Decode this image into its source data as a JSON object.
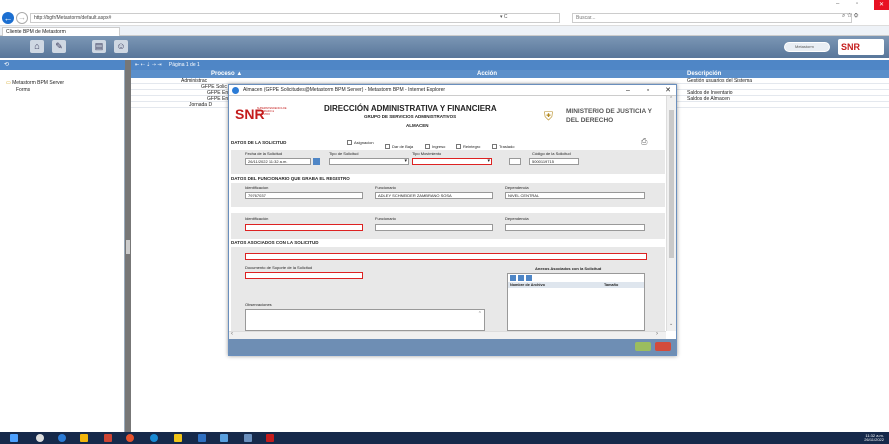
{
  "browser": {
    "url": "http://bgfr/Metastorm/default.aspx#",
    "url_controls": "▾ C",
    "search_placeholder": "Buscar...",
    "tab_title": "Cliente BPM de Metastorm"
  },
  "toolbar": {
    "search_pill": "Metastorm",
    "logo_text": "SNR"
  },
  "left_tree": [
    "Metastorm BPM Server",
    "Forms"
  ],
  "grid": {
    "pager": "Página 1 de 1",
    "headers": [
      "Proceso ▲",
      "Acción",
      "Descripción"
    ],
    "rows": [
      [
        "Administrac",
        "",
        "Gestión usuarios del Sistema"
      ],
      [
        "GFPE Solic",
        "",
        ""
      ],
      [
        "GFPE Ent",
        "",
        "Saldos de Inventario"
      ],
      [
        "GFPE Ent",
        "",
        "Saldos de Almacen"
      ],
      [
        "Jornada D",
        "",
        ""
      ]
    ]
  },
  "popup": {
    "title": "Almacen (GFPE Solicitudes@Metastorm BPM Server) - Metastorm BPM - Internet Explorer",
    "header": {
      "logo": "SNR",
      "logo_sub": "SUPERINTENDENCIA DE NOTARIADO & REGISTRO",
      "title": "DIRECCIÓN ADMINISTRATIVA Y FINANCIERA",
      "subtitle": "GRUPO DE SERVICIOS ADMINISTRATIVOS",
      "sub2": "ALMACEN",
      "ministry": "MINISTERIO DE JUSTICIA Y DEL DERECHO"
    },
    "sec1": {
      "title": "DATOS DE LA SOLICITUD",
      "checks": [
        "Asignacion",
        "Dar de Baja",
        "Ingreso",
        "Reintegro",
        "Traslado"
      ],
      "fecha_label": "Fecha de la Solicitud",
      "fecha": "26/11/2022 11:32 a.m.",
      "tipo_sol_label": "Tipo de Solicitud",
      "tipo_mov_label": "Tipo Movimiento",
      "codigo_label": "Código de la Solicitud",
      "codigo": "5000119715"
    },
    "sec2": {
      "title": "DATOS DEL FUNCIONARIO QUE GRABA EL REGISTRO",
      "id_label": "Identificacion",
      "id": "79767037",
      "func_label": "Funcionario",
      "func": "ADLEY SCHNEIDER ZAMBRANO SOSA",
      "dep_label": "Dependencia",
      "dep": "NIVEL CENTRAL"
    },
    "sec2b": {
      "id_label": "Identificación",
      "func_label": "Funcionario",
      "dep_label": "Dependencia"
    },
    "sec3": {
      "title": "DATOS ASOCIADOS CON LA SOLICITUD",
      "doc_label": "Documento de Soporte de la Solicitud",
      "attach_title": "Anexos Asociados con la Solicitud",
      "col_name": "Nombre de Archivo",
      "col_size": "Tamaño",
      "obs_label": "Observaciones"
    }
  },
  "tray": {
    "time": "11:32 a.m.",
    "date": "26/11/2022"
  },
  "colors": {
    "toolbar": "#58769a",
    "grid_header": "#4f86c6",
    "taskbar": "#16294a",
    "snr_red": "#c41c1c"
  }
}
